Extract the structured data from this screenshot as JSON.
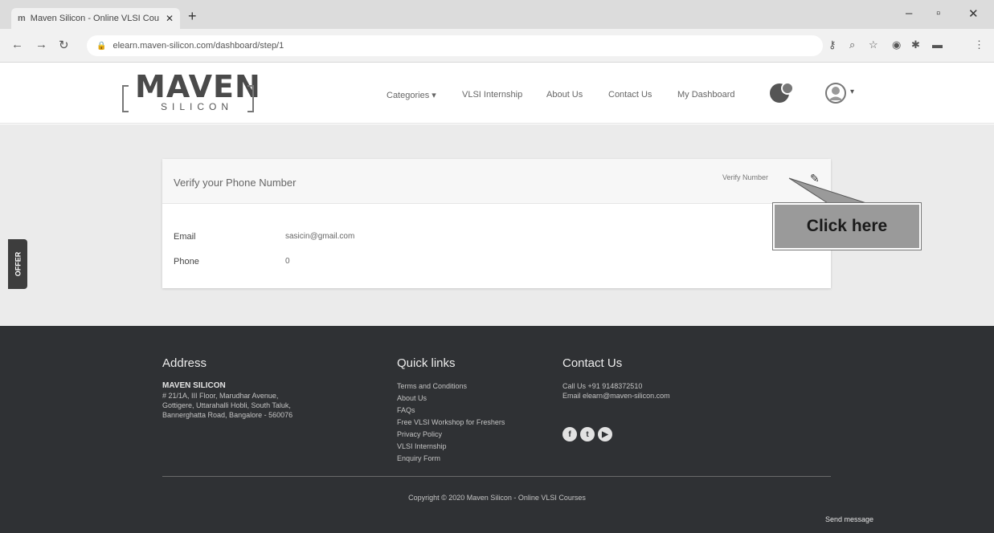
{
  "browser": {
    "tab_title": "Maven Silicon - Online VLSI Cou",
    "tab_favicon": "m",
    "url": "elearn.maven-silicon.com/dashboard/step/1"
  },
  "header": {
    "logo_text": "MAVEN",
    "logo_subtext": "SILICON",
    "nav": {
      "categories": "Categories ▾",
      "internship": "VLSI Internship",
      "about": "About Us",
      "contact": "Contact Us",
      "dashboard": "My Dashboard"
    }
  },
  "offer_tab": "OFFER",
  "verify_card": {
    "title": "Verify your Phone Number",
    "verify_link": "Verify Number",
    "email_label": "Email",
    "email_value": "sasicin@gmail.com",
    "phone_label": "Phone",
    "phone_value": "0"
  },
  "callout": {
    "text": "Click here"
  },
  "footer": {
    "address": {
      "heading": "Address",
      "company": "MAVEN SILICON",
      "line1": "# 21/1A, III Floor, Marudhar Avenue,",
      "line2": "Gottigere, Uttarahalli Hobli, South Taluk,",
      "line3": "Bannerghatta Road, Bangalore - 560076"
    },
    "quick_links": {
      "heading": "Quick links",
      "items": [
        "Terms and Conditions",
        "About Us",
        "FAQs",
        "Free VLSI Workshop for Freshers",
        "Privacy Policy",
        "VLSI Internship",
        "Enquiry Form"
      ]
    },
    "contact": {
      "heading": "Contact Us",
      "call": "Call Us   +91 9148372510",
      "email": "Email     elearn@maven-silicon.com"
    },
    "copyright": "Copyright © 2020 Maven Silicon - Online VLSI Courses",
    "send_message": "Send message"
  }
}
